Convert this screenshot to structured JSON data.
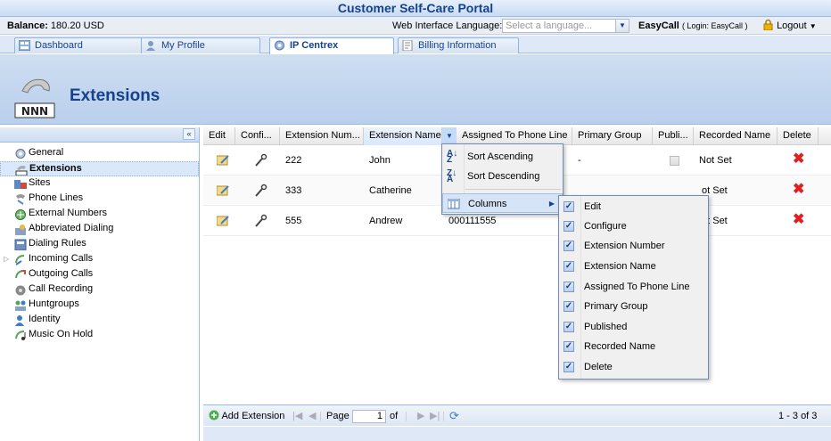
{
  "portal_title": "Customer Self-Care Portal",
  "balance": {
    "label": "Balance:",
    "value": "180.20 USD"
  },
  "language": {
    "label": "Web Interface Language:",
    "placeholder": "Select a language..."
  },
  "user": {
    "name": "EasyCall",
    "login_prefix": "( Login: EasyCall )",
    "logout": "Logout"
  },
  "tabs": [
    {
      "label": "Dashboard",
      "icon": "dashboard-icon"
    },
    {
      "label": "My Profile",
      "icon": "profile-icon"
    },
    {
      "label": "IP Centrex",
      "icon": "gear-icon",
      "active": true
    },
    {
      "label": "Billing Information",
      "icon": "billing-icon"
    }
  ],
  "header": {
    "title": "Extensions",
    "logo_text": "NNN"
  },
  "sidebar": {
    "items": [
      {
        "label": "General",
        "icon": "gear-icon"
      },
      {
        "label": "Extensions",
        "icon": "extensions-icon",
        "selected": true
      },
      {
        "label": "Sites",
        "icon": "sites-icon"
      },
      {
        "label": "Phone Lines",
        "icon": "phone-icon"
      },
      {
        "label": "External Numbers",
        "icon": "external-numbers-icon"
      },
      {
        "label": "Abbreviated Dialing",
        "icon": "abbreviated-dialing-icon"
      },
      {
        "label": "Dialing Rules",
        "icon": "dialing-rules-icon"
      },
      {
        "label": "Incoming Calls",
        "icon": "incoming-calls-icon",
        "expandable": true
      },
      {
        "label": "Outgoing Calls",
        "icon": "outgoing-calls-icon"
      },
      {
        "label": "Call Recording",
        "icon": "call-recording-icon"
      },
      {
        "label": "Huntgroups",
        "icon": "huntgroups-icon"
      },
      {
        "label": "Identity",
        "icon": "identity-icon"
      },
      {
        "label": "Music On Hold",
        "icon": "music-icon"
      }
    ]
  },
  "grid": {
    "columns": [
      "Edit",
      "Confi...",
      "Extension Num...",
      "Extension Name",
      "Assigned To Phone Line",
      "Primary Group",
      "Publi...",
      "Recorded Name",
      "Delete"
    ],
    "rows": [
      {
        "number": "222",
        "name": "John",
        "line": "",
        "group": "-",
        "recorded": "Not Set"
      },
      {
        "number": "333",
        "name": "Catherine",
        "line": "",
        "group": "",
        "recorded": "ot Set"
      },
      {
        "number": "555",
        "name": "Andrew",
        "line": "000111555",
        "group": "",
        "recorded": "ot Set"
      }
    ]
  },
  "sort_menu": {
    "ascending": "Sort Ascending",
    "descending": "Sort Descending",
    "columns": "Columns"
  },
  "columns_menu": {
    "items": [
      "Edit",
      "Configure",
      "Extension Number",
      "Extension Name",
      "Assigned To Phone Line",
      "Primary Group",
      "Published",
      "Recorded Name",
      "Delete"
    ]
  },
  "toolbar": {
    "add": "Add Extension",
    "page_label": "Page",
    "page_value": "1",
    "of_label": "of",
    "count": "1 - 3 of 3"
  }
}
